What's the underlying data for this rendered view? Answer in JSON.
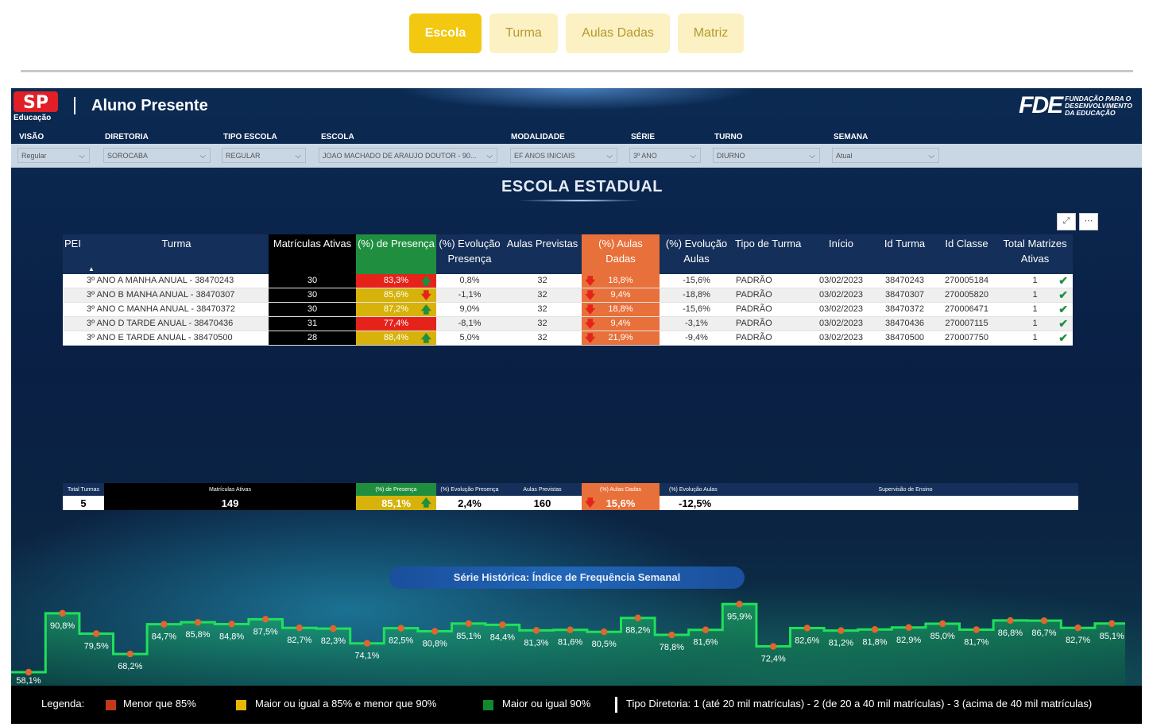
{
  "nav": {
    "tabs": [
      {
        "label": "Escola",
        "active": true
      },
      {
        "label": "Turma",
        "active": false
      },
      {
        "label": "Aulas Dadas",
        "active": false
      },
      {
        "label": "Matriz",
        "active": false
      }
    ]
  },
  "header": {
    "logo_text": "SP",
    "logo_subtitle": "Educação",
    "title": "Aluno Presente",
    "fde_mark": "FDE",
    "fde_text": [
      "FUNDAÇÃO PARA O",
      "DESENVOLVIMENTO",
      "DA EDUCAÇÃO"
    ]
  },
  "filters": [
    {
      "label": "VISÃO",
      "value": "Regular"
    },
    {
      "label": "DIRETORIA",
      "value": "SOROCABA"
    },
    {
      "label": "TIPO ESCOLA",
      "value": "REGULAR"
    },
    {
      "label": "ESCOLA",
      "value": "JOAO MACHADO DE ARAUJO DOUTOR - 90..."
    },
    {
      "label": "MODALIDADE",
      "value": "EF ANOS INICIAIS"
    },
    {
      "label": "SÉRIE",
      "value": "3º ANO"
    },
    {
      "label": "TURNO",
      "value": "DIURNO"
    },
    {
      "label": "SEMANA",
      "value": "Atual"
    }
  ],
  "section_title": "ESCOLA ESTADUAL",
  "colors": {
    "red": "#e5231b",
    "yellow": "#d6b20a",
    "green": "#1f8f3f",
    "orange": "#e8703a",
    "navy": "#142f59",
    "legend_red": "#c0391b",
    "legend_yellow": "#e8b800",
    "legend_green": "#0f8a2e"
  },
  "table": {
    "headers": [
      "PEI",
      "Turma",
      "Matrículas Ativas",
      "(%) de Presença",
      "(%) Evolução Presença",
      "Aulas Previstas",
      "(%) Aulas Dadas",
      "(%) Evolução Aulas",
      "Tipo de Turma",
      "Início",
      "Id Turma",
      "Id Classe",
      "Total Matrizes Ativas"
    ],
    "sort_indicator": "▲",
    "rows": [
      {
        "pei": "",
        "turma": "3º ANO A MANHA ANUAL - 38470243",
        "matriculas": "30",
        "presenca": "83,3%",
        "presenca_status": "red",
        "presenca_trend": "up",
        "evol_presenca": "0,8%",
        "aulas_previstas": "32",
        "aulas_dadas": "18,8%",
        "evol_aulas": "-15,6%",
        "tipo": "PADRÃO",
        "inicio": "03/02/2023",
        "id_turma": "38470243",
        "id_classe": "270005184",
        "total_matrizes": "1"
      },
      {
        "pei": "",
        "turma": "3º ANO B MANHA ANUAL - 38470307",
        "matriculas": "30",
        "presenca": "85,6%",
        "presenca_status": "yellow",
        "presenca_trend": "down",
        "evol_presenca": "-1,1%",
        "aulas_previstas": "32",
        "aulas_dadas": "9,4%",
        "evol_aulas": "-18,8%",
        "tipo": "PADRÃO",
        "inicio": "03/02/2023",
        "id_turma": "38470307",
        "id_classe": "270005820",
        "total_matrizes": "1"
      },
      {
        "pei": "",
        "turma": "3º ANO C MANHA ANUAL - 38470372",
        "matriculas": "30",
        "presenca": "87,2%",
        "presenca_status": "yellow",
        "presenca_trend": "up",
        "evol_presenca": "9,0%",
        "aulas_previstas": "32",
        "aulas_dadas": "18,8%",
        "evol_aulas": "-15,6%",
        "tipo": "PADRÃO",
        "inicio": "03/02/2023",
        "id_turma": "38470372",
        "id_classe": "270006471",
        "total_matrizes": "1"
      },
      {
        "pei": "",
        "turma": "3º ANO D TARDE ANUAL - 38470436",
        "matriculas": "31",
        "presenca": "77,4%",
        "presenca_status": "red",
        "presenca_trend": "down",
        "evol_presenca": "-8,1%",
        "aulas_previstas": "32",
        "aulas_dadas": "9,4%",
        "evol_aulas": "-3,1%",
        "tipo": "PADRÃO",
        "inicio": "03/02/2023",
        "id_turma": "38470436",
        "id_classe": "270007115",
        "total_matrizes": "1"
      },
      {
        "pei": "",
        "turma": "3º ANO E TARDE ANUAL - 38470500",
        "matriculas": "28",
        "presenca": "88,4%",
        "presenca_status": "yellow",
        "presenca_trend": "up",
        "evol_presenca": "5,0%",
        "aulas_previstas": "32",
        "aulas_dadas": "21,9%",
        "evol_aulas": "-9,4%",
        "tipo": "PADRÃO",
        "inicio": "03/02/2023",
        "id_turma": "38470500",
        "id_classe": "270007750",
        "total_matrizes": "1"
      }
    ]
  },
  "summary": {
    "headers": [
      "Total Turmas",
      "Matrículas Ativas",
      "(%) de Presença",
      "(%) Evolução Presença",
      "Aulas Previstas",
      "(%) Aulas Dadas",
      "(%) Evolução Aulas",
      "Supervisão de Ensino"
    ],
    "values": {
      "total_turmas": "5",
      "matriculas": "149",
      "presenca": "85,1%",
      "evol_presenca": "2,4%",
      "aulas_previstas": "160",
      "aulas_dadas": "15,6%",
      "evol_aulas": "-12,5%",
      "supervisao": ""
    }
  },
  "chart_title": "Série Histórica: Índice de Frequência Semanal",
  "chart_data": {
    "type": "area",
    "title": "Série Histórica: Índice de Frequência Semanal",
    "step": true,
    "values": [
      58.1,
      90.8,
      79.5,
      68.2,
      84.7,
      85.8,
      84.8,
      87.5,
      82.7,
      82.3,
      74.1,
      82.5,
      80.8,
      85.1,
      84.4,
      81.3,
      81.6,
      80.5,
      88.2,
      78.8,
      81.6,
      95.9,
      72.4,
      82.6,
      81.2,
      81.8,
      82.9,
      85.0,
      81.7,
      86.8,
      86.7,
      82.7,
      85.1
    ],
    "labels": [
      "58,1%",
      "90,8%",
      "79,5%",
      "68,2%",
      "84,7%",
      "85,8%",
      "84,8%",
      "87,5%",
      "82,7%",
      "82,3%",
      "74,1%",
      "82,5%",
      "80,8%",
      "85,1%",
      "84,4%",
      "81,3%",
      "81,6%",
      "80,5%",
      "88,2%",
      "78,8%",
      "81,6%",
      "95,9%",
      "72,4%",
      "82,6%",
      "81,2%",
      "81,8%",
      "82,9%",
      "85,0%",
      "81,7%",
      "86,8%",
      "86,7%",
      "82,7%",
      "85,1%"
    ],
    "line_color": "#1fe05a",
    "marker_color": "#e0652e"
  },
  "legend": {
    "title": "Legenda:",
    "items": [
      "Menor que 85%",
      "Maior ou igual a 85% e menor que 90%",
      "Maior ou igual 90%"
    ],
    "tipo_diretoria": "Tipo Diretoria: 1 (até 20 mil matrículas) - 2 (de 20 a 40 mil matrículas) - 3 (acima de 40 mil matrículas)"
  }
}
